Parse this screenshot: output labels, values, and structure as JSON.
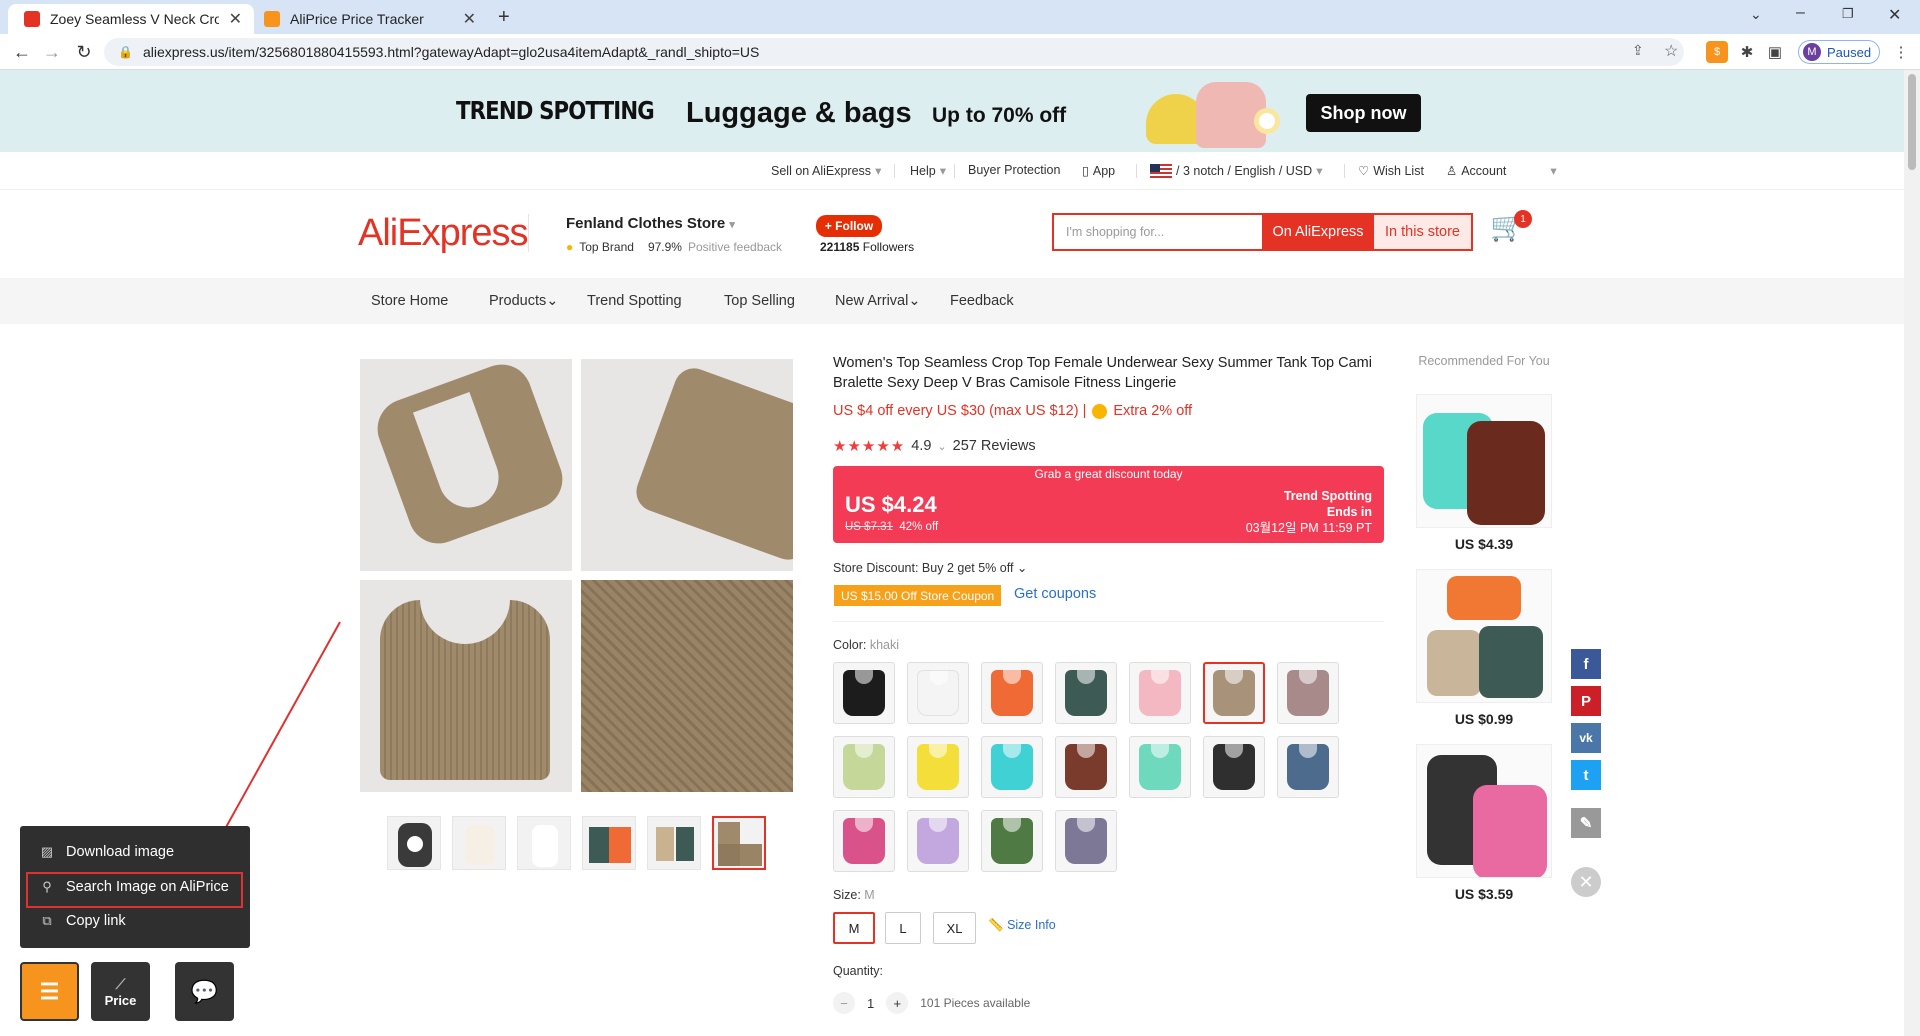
{
  "browser": {
    "tabs": [
      {
        "title": "Zoey Seamless V Neck Croppe",
        "favicon": "aliexpress-icon",
        "color": "#e43225"
      },
      {
        "title": "AliPrice Price Tracker",
        "favicon": "aliprice-icon",
        "color": "#f7941d"
      }
    ],
    "url": "aliexpress.us/item/3256801880415593.html?gatewayAdapt=glo2usa4itemAdapt&_randl_shipto=US",
    "profile_initial": "M",
    "profile_status": "Paused"
  },
  "banner": {
    "left_text": "TREND SPOTTING",
    "headline": "Luggage & bags",
    "offer": "Up to 70% off",
    "cta": "Shop now"
  },
  "topnav": {
    "sell": "Sell on AliExpress",
    "help": "Help",
    "buyer_protection": "Buyer Protection",
    "app": "App",
    "locale": "/ 3 notch / English /  USD",
    "wishlist": "Wish List",
    "account": "Account"
  },
  "store": {
    "logo": "AliExpress",
    "name": "Fenland Clothes Store",
    "badge": "Top Brand",
    "feedback_pct": "97.9%",
    "feedback_label": "Positive feedback",
    "follow_label": "+ Follow",
    "followers_count": "221185",
    "followers_label": "Followers",
    "search_placeholder": "I'm shopping for...",
    "search_btn_site": "On AliExpress",
    "search_btn_store": "In this store",
    "cart_count": "1"
  },
  "storemenu": [
    "Store Home",
    "Products",
    "Trend Spotting",
    "Top Selling",
    "New Arrival",
    "Feedback"
  ],
  "product": {
    "title": "Women's Top Seamless Crop Top Female Underwear Sexy Summer Tank Top Cami Bralette Sexy Deep V Bras Camisole Fitness Lingerie",
    "promo": "US $4 off every US $30 (max US $12)  |",
    "extra": "Extra 2% off",
    "rating": "4.9",
    "reviews": "257 Reviews",
    "grab": "Grab a great discount today",
    "price": "US $4.24",
    "old_price": "US $7.31",
    "discount": "42% off",
    "ts_title": "Trend Spotting",
    "ts_ends": "Ends in",
    "ts_time": "03월12일 PM 11:59 PT",
    "store_discount": "Store Discount: Buy 2 get 5% off",
    "coupon": "US $15.00 Off Store Coupon",
    "get_coupons": "Get coupons",
    "color_label": "Color:",
    "color_value": "khaki",
    "colors": [
      "#1c1c1c",
      "#f4f4f4",
      "#f06a35",
      "#3d5a55",
      "#f3b8c2",
      "#a8937a",
      "#a88a8a",
      "#c6d79a",
      "#f4df3a",
      "#3fd1d3",
      "#7a3a2c",
      "#6fd9bd",
      "#2f2f2f",
      "#4c6b8d",
      "#d9528a",
      "#c3a8e0",
      "#4f7a43",
      "#7d7895"
    ],
    "size_label": "Size:",
    "size_value": "M",
    "sizes": [
      "M",
      "L",
      "XL"
    ],
    "size_info": "Size Info",
    "qty_label": "Quantity:",
    "qty": "1",
    "available": "101 Pieces available"
  },
  "recommended": {
    "heading": "Recommended For You",
    "items": [
      {
        "price": "US $4.39"
      },
      {
        "price": "US $0.99"
      },
      {
        "price": "US $3.59"
      }
    ]
  },
  "aliprice": {
    "menu": [
      "Download image",
      "Search Image on AliPrice",
      "Copy link"
    ],
    "price_btn": "Price"
  }
}
